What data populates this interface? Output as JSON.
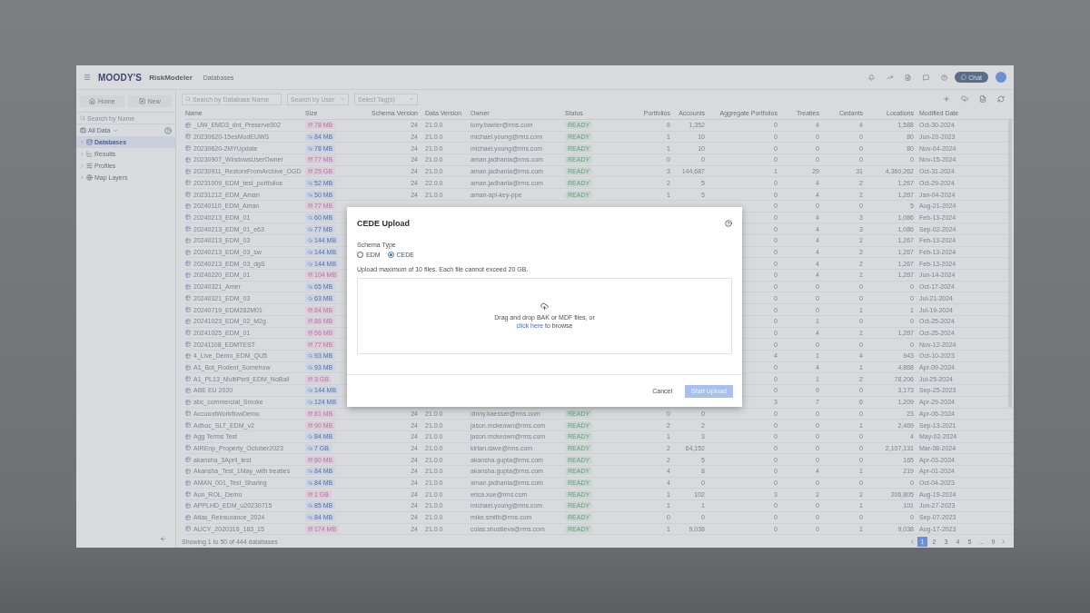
{
  "top_bar": {
    "brand": "MOODY'S",
    "product": "RiskModeler",
    "section": "Databases",
    "chat_label": "Chat"
  },
  "sidebar": {
    "buttons": [
      "Home",
      "New"
    ],
    "search": {
      "placeholder": "Search by Name"
    },
    "scope": "All Data",
    "items": [
      {
        "label": "Databases",
        "selected": true,
        "kind": "database"
      },
      {
        "label": "Results",
        "selected": false,
        "kind": "results"
      },
      {
        "label": "Profiles",
        "selected": false,
        "kind": "profiles"
      },
      {
        "label": "Map Layers",
        "selected": false,
        "kind": "map"
      }
    ]
  },
  "filters": {
    "search": {
      "placeholder": "Search by Database Name"
    },
    "user": {
      "placeholder": "Search by User"
    },
    "tags": {
      "placeholder": "Select Tag(s)"
    }
  },
  "table": {
    "columns": [
      "Name",
      "Size",
      "Schema Version",
      "Data Version",
      "Owner",
      "Status",
      "Portfolios",
      "Accounts",
      "Aggregate Portfolios",
      "Treaties",
      "Cedants",
      "Locations",
      "Modified Date"
    ],
    "rows": [
      {
        "name": "_UW_EMD3_dnt_Preserve002",
        "size": "78 MB",
        "kind": "local",
        "schema": "24",
        "data": "21.0.0",
        "owner": "lorry.baxter@rms.com",
        "status": "READY",
        "portfolios": "6",
        "accounts": "1,352",
        "aggregate": "0",
        "treaties": "4",
        "cedants": "4",
        "locations": "1,588",
        "modified": "Oct-30-2024"
      },
      {
        "name": "20230620-15esModEUWS",
        "size": "84 MB",
        "kind": "cloud",
        "schema": "24",
        "data": "21.0.0",
        "owner": "michael.young@rms.com",
        "status": "READY",
        "portfolios": "1",
        "accounts": "10",
        "aggregate": "0",
        "treaties": "0",
        "cedants": "0",
        "locations": "80",
        "modified": "Jun-20-2023"
      },
      {
        "name": "20230620-2MYUpdate",
        "size": "78 MB",
        "kind": "cloud",
        "schema": "24",
        "data": "21.0.0",
        "owner": "michael.young@rms.com",
        "status": "READY",
        "portfolios": "1",
        "accounts": "10",
        "aggregate": "0",
        "treaties": "0",
        "cedants": "0",
        "locations": "80",
        "modified": "Nov-04-2024"
      },
      {
        "name": "20230907_WindowsUserOwner",
        "size": "77 MB",
        "kind": "local",
        "schema": "24",
        "data": "21.0.0",
        "owner": "aman.jadhania@rms.com",
        "status": "READY",
        "portfolios": "0",
        "accounts": "0",
        "aggregate": "0",
        "treaties": "0",
        "cedants": "0",
        "locations": "0",
        "modified": "Nov-15-2024"
      },
      {
        "name": "20230911_RestoreFromArchive_OGD",
        "size": "25 GB",
        "kind": "local",
        "schema": "24",
        "data": "21.0.0",
        "owner": "aman.jadhania@rms.com",
        "status": "READY",
        "portfolios": "3",
        "accounts": "144,687",
        "aggregate": "1",
        "treaties": "29",
        "cedants": "31",
        "locations": "4,360,262",
        "modified": "Oct-31-2024"
      },
      {
        "name": "20231009_EDM_test_portfolios",
        "size": "52 MB",
        "kind": "cloud",
        "schema": "24",
        "data": "22.0.0",
        "owner": "aman.jadhania@rms.com",
        "status": "READY",
        "portfolios": "2",
        "accounts": "5",
        "aggregate": "0",
        "treaties": "4",
        "cedants": "2",
        "locations": "1,267",
        "modified": "Oct-29-2024"
      },
      {
        "name": "20231212_EDM_Aman",
        "size": "50 MB",
        "kind": "cloud",
        "schema": "24",
        "data": "21.0.0",
        "owner": "aman-api-key-ppe",
        "status": "READY",
        "portfolios": "1",
        "accounts": "5",
        "aggregate": "0",
        "treaties": "4",
        "cedants": "2",
        "locations": "1,267",
        "modified": "Jan-04-2024"
      },
      {
        "name": "20240110_EDM_Aman",
        "size": "77 MB",
        "kind": "local",
        "aggregate": "0",
        "treaties": "0",
        "cedants": "0",
        "locations": "5",
        "modified": "Aug-21-2024"
      },
      {
        "name": "20240213_EDM_01",
        "size": "60 MB",
        "kind": "cloud",
        "aggregate": "0",
        "treaties": "4",
        "cedants": "3",
        "locations": "1,086",
        "modified": "Feb-13-2024"
      },
      {
        "name": "20240213_EDM_01_e63",
        "size": "77 MB",
        "kind": "cloud",
        "aggregate": "0",
        "treaties": "4",
        "cedants": "3",
        "locations": "1,086",
        "modified": "Sep-02-2024"
      },
      {
        "name": "20240213_EDM_03",
        "size": "144 MB",
        "kind": "cloud",
        "aggregate": "0",
        "treaties": "4",
        "cedants": "2",
        "locations": "1,267",
        "modified": "Feb-13-2024"
      },
      {
        "name": "20240213_EDM_03_sw",
        "size": "144 MB",
        "kind": "cloud",
        "aggregate": "0",
        "treaties": "4",
        "cedants": "2",
        "locations": "1,267",
        "modified": "Feb-13-2024"
      },
      {
        "name": "20240213_EDM_03_dgS",
        "size": "144 MB",
        "kind": "cloud",
        "aggregate": "0",
        "treaties": "4",
        "cedants": "2",
        "locations": "1,267",
        "modified": "Feb-13-2024"
      },
      {
        "name": "20240220_EDM_01",
        "size": "104 MB",
        "kind": "local",
        "aggregate": "0",
        "treaties": "4",
        "cedants": "2",
        "locations": "1,267",
        "modified": "Jun-14-2024"
      },
      {
        "name": "20240321_Amer",
        "size": "65 MB",
        "kind": "cloud",
        "aggregate": "0",
        "treaties": "0",
        "cedants": "0",
        "locations": "0",
        "modified": "Oct-17-2024"
      },
      {
        "name": "20240321_EDM_03",
        "size": "63 MB",
        "kind": "cloud",
        "aggregate": "0",
        "treaties": "0",
        "cedants": "0",
        "locations": "0",
        "modified": "Jul-21-2024"
      },
      {
        "name": "20240719_EDM282M01",
        "size": "84 MB",
        "kind": "local",
        "aggregate": "0",
        "treaties": "0",
        "cedants": "1",
        "locations": "1",
        "modified": "Jul-19-2024"
      },
      {
        "name": "20241023_EDM_02_M2g",
        "size": "86 MB",
        "kind": "local",
        "aggregate": "0",
        "treaties": "1",
        "cedants": "0",
        "locations": "0",
        "modified": "Oct-25-2024"
      },
      {
        "name": "20241025_EDM_01",
        "size": "56 MB",
        "kind": "local",
        "aggregate": "0",
        "treaties": "4",
        "cedants": "2",
        "locations": "1,267",
        "modified": "Oct-25-2024"
      },
      {
        "name": "20241108_EDMTEST",
        "size": "77 MB",
        "kind": "local",
        "aggregate": "0",
        "treaties": "0",
        "cedants": "0",
        "locations": "0",
        "modified": "Nov-12-2024"
      },
      {
        "name": "4_Live_Demo_EDM_QU5",
        "size": "93 MB",
        "kind": "cloud",
        "aggregate": "4",
        "treaties": "1",
        "cedants": "4",
        "locations": "943",
        "modified": "Oct-10-2023"
      },
      {
        "name": "A1_Bot_Rodent_Somehow",
        "size": "93 MB",
        "kind": "cloud",
        "aggregate": "0",
        "treaties": "4",
        "cedants": "1",
        "locations": "4,868",
        "modified": "Apr-09-2024"
      },
      {
        "name": "A1_PL13_MultiPeril_EDM_NoBall",
        "size": "3 GB",
        "kind": "local",
        "aggregate": "0",
        "treaties": "1",
        "cedants": "2",
        "locations": "78,206",
        "modified": "Jul-25-2024"
      },
      {
        "name": "ABE EU 2020",
        "size": "144 MB",
        "kind": "cloud",
        "aggregate": "0",
        "treaties": "9",
        "cedants": "0",
        "locations": "3,173",
        "modified": "Sep-25-2023"
      },
      {
        "name": "abc_commercial_Smoke",
        "size": "124 MB",
        "kind": "cloud",
        "aggregate": "3",
        "treaties": "7",
        "cedants": "6",
        "locations": "1,209",
        "modified": "Apr-29-2024"
      },
      {
        "name": "AccountWorkflowDemo",
        "size": "81 MB",
        "kind": "local",
        "schema": "24",
        "data": "21.0.0",
        "owner": "dinny.kaesser@rms.com",
        "status": "READY",
        "portfolios": "0",
        "accounts": "0",
        "aggregate": "0",
        "treaties": "0",
        "cedants": "0",
        "locations": "23",
        "modified": "Apr-05-2024"
      },
      {
        "name": "Adhoc_SLT_EDM_v2",
        "size": "90 MB",
        "kind": "local",
        "schema": "24",
        "data": "21.0.0",
        "owner": "jason.mckeown@rms.com",
        "status": "READY",
        "portfolios": "2",
        "accounts": "2",
        "aggregate": "0",
        "treaties": "0",
        "cedants": "1",
        "locations": "2,469",
        "modified": "Sep-13-2021"
      },
      {
        "name": "Agg Terms Test",
        "size": "84 MB",
        "kind": "cloud",
        "schema": "24",
        "data": "21.0.0",
        "owner": "jason.mckeown@rms.com",
        "status": "READY",
        "portfolios": "1",
        "accounts": "3",
        "aggregate": "0",
        "treaties": "0",
        "cedants": "0",
        "locations": "4",
        "modified": "May-02-2024"
      },
      {
        "name": "AIREnp_Property_October2023",
        "size": "7 GB",
        "kind": "cloud",
        "schema": "24",
        "data": "21.0.0",
        "owner": "kirtan.dave@rms.com",
        "status": "READY",
        "portfolios": "2",
        "accounts": "64,152",
        "aggregate": "0",
        "treaties": "0",
        "cedants": "0",
        "locations": "2,107,131",
        "modified": "Mar-08-2024"
      },
      {
        "name": "akansha_3April_test",
        "size": "80 MB",
        "kind": "local",
        "schema": "24",
        "data": "21.0.0",
        "owner": "akansha.gupta@rms.com",
        "status": "READY",
        "portfolios": "2",
        "accounts": "5",
        "aggregate": "0",
        "treaties": "0",
        "cedants": "0",
        "locations": "165",
        "modified": "Apr-03-2024"
      },
      {
        "name": "Akansha_Test_1May_with treaties",
        "size": "84 MB",
        "kind": "cloud",
        "schema": "24",
        "data": "21.0.0",
        "owner": "akansha.gupta@rms.com",
        "status": "READY",
        "portfolios": "4",
        "accounts": "8",
        "aggregate": "0",
        "treaties": "4",
        "cedants": "1",
        "locations": "219",
        "modified": "Apr-01-2024"
      },
      {
        "name": "AMAN_001_Test_Sharing",
        "size": "84 MB",
        "kind": "cloud",
        "schema": "24",
        "data": "21.0.0",
        "owner": "aman.jadhania@rms.com",
        "status": "READY",
        "portfolios": "4",
        "accounts": "0",
        "aggregate": "0",
        "treaties": "0",
        "cedants": "0",
        "locations": "0",
        "modified": "Oct-04-2023"
      },
      {
        "name": "Aon_ROL_Demo",
        "size": "1 GB",
        "kind": "local",
        "schema": "24",
        "data": "21.0.0",
        "owner": "erica.xue@rms.com",
        "status": "READY",
        "portfolios": "1",
        "accounts": "102",
        "aggregate": "3",
        "treaties": "2",
        "cedants": "2",
        "locations": "206,805",
        "modified": "Aug-19-2024"
      },
      {
        "name": "APPLHD_EDM_u20230715",
        "size": "85 MB",
        "kind": "cloud",
        "schema": "24",
        "data": "21.0.0",
        "owner": "michael.young@rms.com",
        "status": "READY",
        "portfolios": "1",
        "accounts": "1",
        "aggregate": "0",
        "treaties": "0",
        "cedants": "1",
        "locations": "101",
        "modified": "Jun-27-2023"
      },
      {
        "name": "Atlas_Reinsurance_2024",
        "size": "84 MB",
        "kind": "cloud",
        "schema": "24",
        "data": "21.0.0",
        "owner": "mike.smith@rms.com",
        "status": "READY",
        "portfolios": "0",
        "accounts": "0",
        "aggregate": "0",
        "treaties": "0",
        "cedants": "0",
        "locations": "0",
        "modified": "Sep-07-2023"
      },
      {
        "name": "AUCY_2020318_183_15",
        "size": "174 MB",
        "kind": "local",
        "schema": "24",
        "data": "21.0.0",
        "owner": "colas.shustleva@rms.com",
        "status": "READY",
        "portfolios": "1",
        "accounts": "9,038",
        "aggregate": "0",
        "treaties": "0",
        "cedants": "1",
        "locations": "9,038",
        "modified": "Aug-17-2023"
      }
    ]
  },
  "footer": {
    "summary": "Showing 1 to 50 of 444 databases",
    "pages": [
      {
        "label": "1",
        "selected": true
      },
      {
        "label": "2",
        "selected": false
      },
      {
        "label": "3",
        "selected": false
      },
      {
        "label": "4",
        "selected": false
      },
      {
        "label": "5",
        "selected": false
      },
      {
        "label": "...",
        "selected": false
      },
      {
        "label": "9",
        "selected": false
      }
    ]
  },
  "modal": {
    "title": "CEDE Upload",
    "schema_label": "Schema Type",
    "options": [
      {
        "label": "EDM",
        "selected": false
      },
      {
        "label": "CEDE",
        "selected": true
      }
    ],
    "limit_note": "Upload maximum of 10 files. Each file cannot exceed 20 GB.",
    "drop_text": "Drag and drop BAK or MDF files, or",
    "browse_link": "click here",
    "browse_rest": "to browse",
    "buttons": [
      {
        "label": "Cancel",
        "kind": "secondary",
        "disabled": false
      },
      {
        "label": "Start Upload",
        "kind": "primary",
        "disabled": true
      }
    ]
  }
}
